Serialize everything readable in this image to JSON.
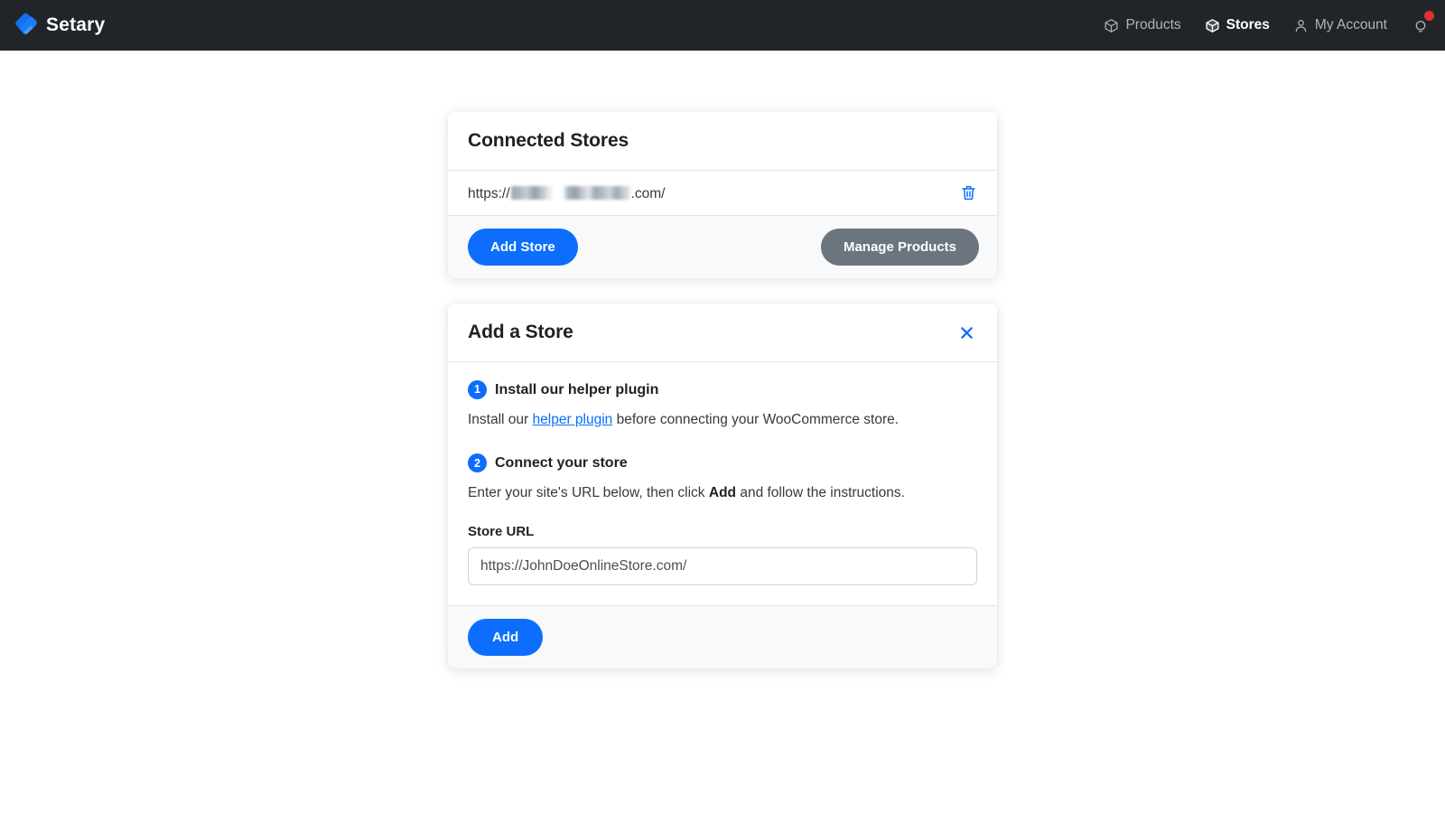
{
  "brand": {
    "name": "Setary",
    "logo_icon": "setary-diamond-logo",
    "logo_color": "#1271f2"
  },
  "nav": {
    "items": [
      {
        "label": "Products",
        "icon": "cube-outline-icon",
        "active": false
      },
      {
        "label": "Stores",
        "icon": "cube-filled-icon",
        "active": true
      },
      {
        "label": "My Account",
        "icon": "person-icon",
        "active": false
      }
    ],
    "tips": {
      "icon": "lightbulb-icon",
      "badge_visible": true,
      "badge_color": "#e03131"
    }
  },
  "connected_stores": {
    "title": "Connected Stores",
    "stores": [
      {
        "url_prefix": "https://",
        "url_redacted": true,
        "url_suffix": ".com/",
        "delete_icon": "trash-icon"
      }
    ],
    "add_store_label": "Add Store",
    "manage_products_label": "Manage Products"
  },
  "add_store": {
    "title": "Add a Store",
    "close_icon": "close-x-icon",
    "steps": [
      {
        "number": "1",
        "title": "Install our helper plugin",
        "text_before": "Install our ",
        "link_text": "helper plugin",
        "text_after": " before connecting your WooCommerce store."
      },
      {
        "number": "2",
        "title": "Connect your store",
        "text_before": "Enter your site's URL below, then click ",
        "bold_text": "Add",
        "text_after": " and follow the instructions."
      }
    ],
    "field": {
      "label": "Store URL",
      "value": "",
      "placeholder": "https://JohnDoeOnlineStore.com/"
    },
    "submit_label": "Add"
  },
  "colors": {
    "nav_background": "#212529",
    "primary": "#0d6efd",
    "secondary": "#6c757d",
    "page_background": "#ffffff",
    "card_footer": "#f8f9fa"
  }
}
